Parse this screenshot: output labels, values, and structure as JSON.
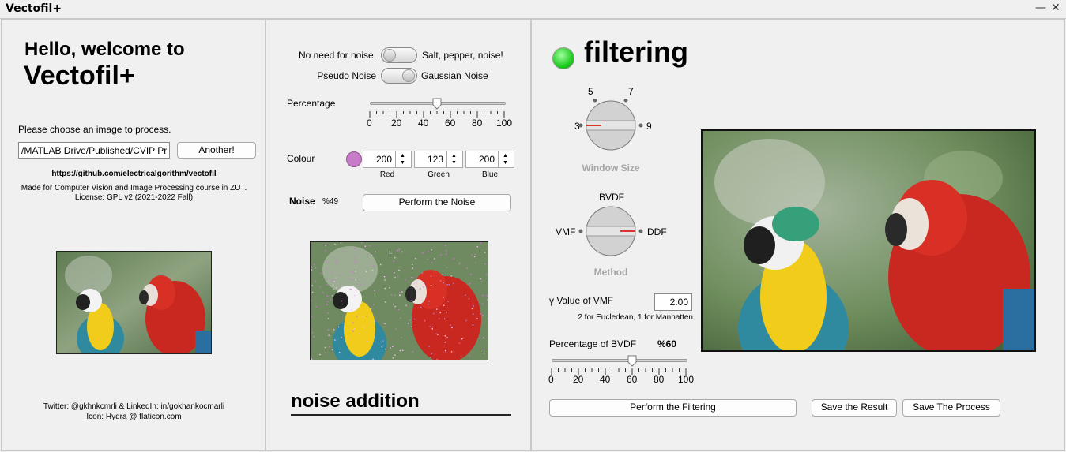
{
  "window": {
    "title": "Vectofil+",
    "minimize_glyph": "—",
    "close_glyph": "✕"
  },
  "left": {
    "welcome_line1": "Hello, welcome to",
    "welcome_line2": "Vectofil+",
    "choose_label": "Please choose an image to process.",
    "path_value": "/MATLAB Drive/Published/CVIP Pr",
    "another_button": "Another!",
    "github_link": "https://github.com/electricalgorithm/vectofil",
    "made_for": "Made for Computer Vision and Image Processing course in ZUT.",
    "license": "License: GPL v2 (2021-2022 Fall)",
    "twitter": "Twitter: @gkhnkcmrli & LinkedIn: in/gokhankocmarli",
    "icon_credit": "Icon: Hydra @ flaticon.com"
  },
  "middle": {
    "toggle1_left": "No need for noise.",
    "toggle1_right": "Salt, pepper, noise!",
    "toggle2_left": "Pseudo Noise",
    "toggle2_right": "Gaussian Noise",
    "percentage_label": "Percentage",
    "percentage_value": 50,
    "percentage_ticks": [
      "0",
      "20",
      "40",
      "60",
      "80",
      "100"
    ],
    "colour_label": "Colour",
    "colour_swatch": "#c87bc8",
    "red_value": "200",
    "green_value": "123",
    "blue_value": "200",
    "red_label": "Red",
    "green_label": "Green",
    "blue_label": "Blue",
    "noise_label": "Noise",
    "noise_percent": "%49",
    "perform_noise_button": "Perform the Noise",
    "section_title": "noise addition"
  },
  "right": {
    "status_color": "#22cc22",
    "title": "filtering",
    "window_size_label": "Window Size",
    "window_size_options": [
      "3",
      "5",
      "7",
      "9"
    ],
    "window_size_selected": "3",
    "method_label": "Method",
    "method_options": [
      "VMF",
      "BVDF",
      "DDF"
    ],
    "method_selected": "DDF",
    "gamma_label": "γ Value of VMF",
    "gamma_value": "2.00",
    "gamma_hint": "2 for Eucledean, 1 for Manhatten",
    "bvdf_label": "Percentage of BVDF",
    "bvdf_value_text": "%60",
    "bvdf_value": 60,
    "bvdf_ticks": [
      "0",
      "20",
      "40",
      "60",
      "80",
      "100"
    ],
    "perform_filter_button": "Perform the Filtering",
    "save_result_button": "Save the Result",
    "save_process_button": "Save The Process"
  }
}
